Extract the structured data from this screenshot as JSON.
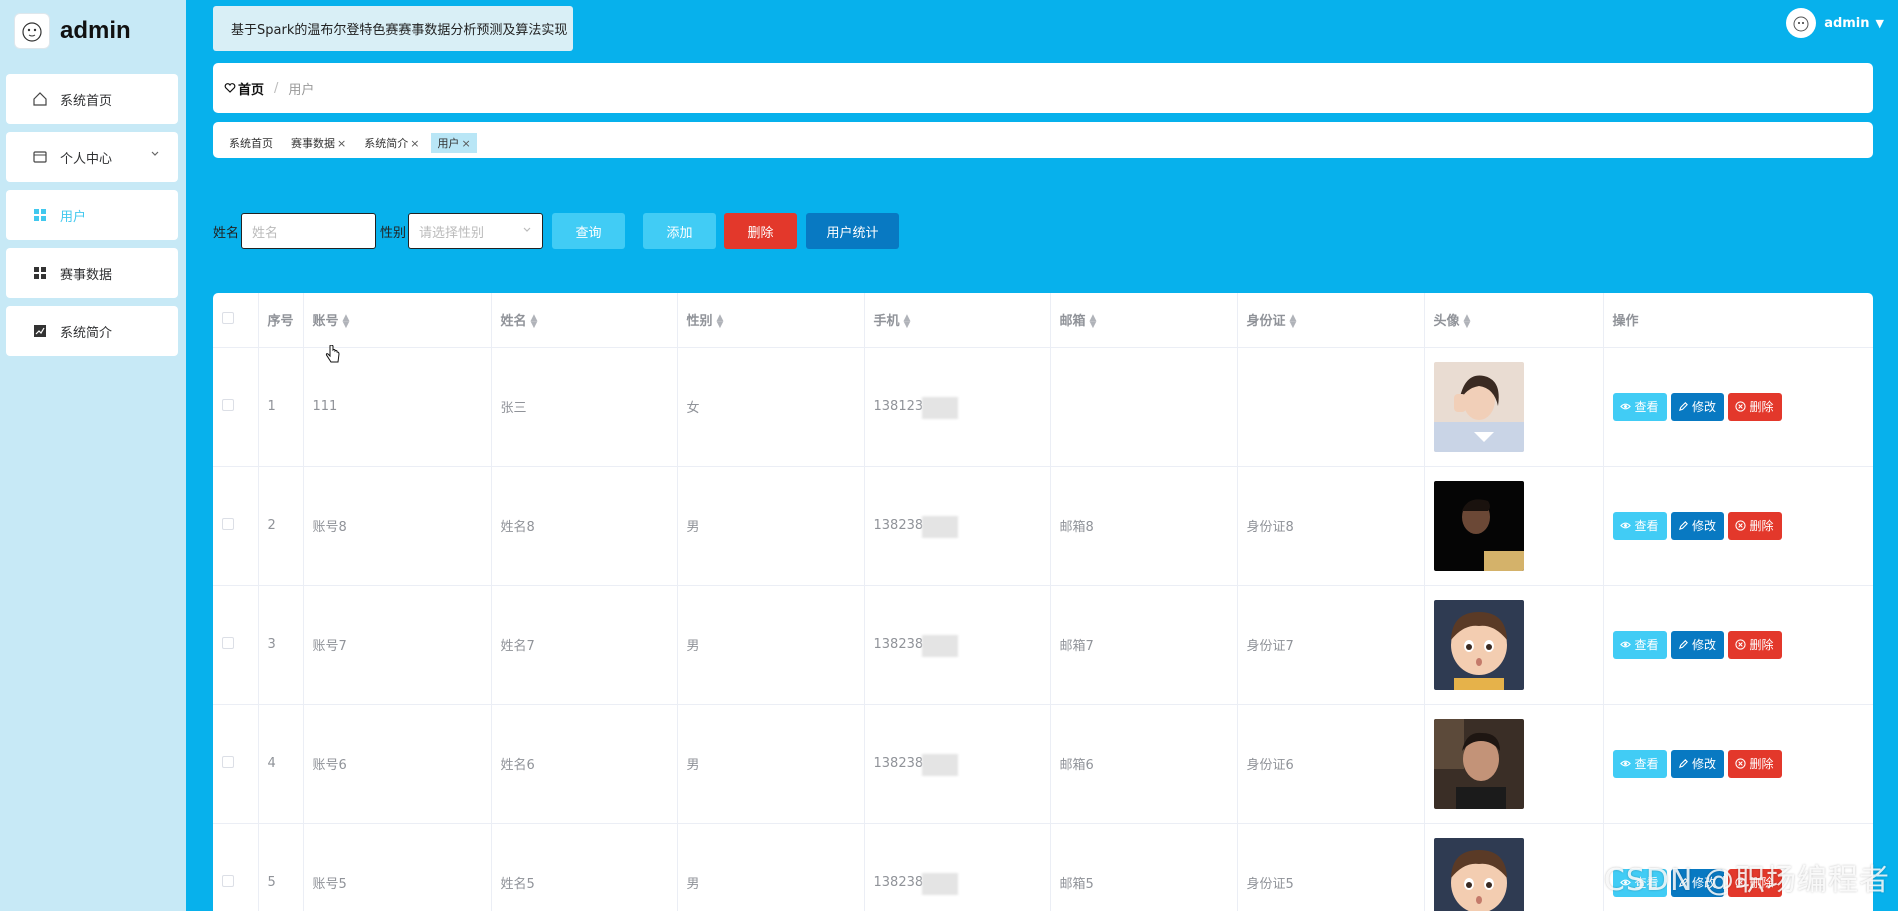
{
  "brand": {
    "name": "admin"
  },
  "sidebar": {
    "items": [
      {
        "label": "系统首页",
        "icon": "home-icon"
      },
      {
        "label": "个人中心",
        "icon": "card-icon"
      },
      {
        "label": "用户",
        "icon": "grid-icon"
      },
      {
        "label": "赛事数据",
        "icon": "grid-icon"
      },
      {
        "label": "系统简介",
        "icon": "chart-icon"
      }
    ]
  },
  "header": {
    "title": "基于Spark的温布尔登特色赛赛事数据分析预测及算法实现",
    "user": "admin"
  },
  "breadcrumb": {
    "home": "首页",
    "separator": "/",
    "current": "用户"
  },
  "tags": [
    {
      "label": "系统首页",
      "closable": false
    },
    {
      "label": "赛事数据",
      "closable": true
    },
    {
      "label": "系统简介",
      "closable": true
    },
    {
      "label": "用户",
      "closable": true
    }
  ],
  "search": {
    "name_label": "姓名",
    "name_placeholder": "姓名",
    "gender_label": "性别",
    "gender_placeholder": "请选择性别",
    "query": "查询",
    "add": "添加",
    "delete": "删除",
    "stats": "用户统计"
  },
  "table": {
    "headers": {
      "index": "序号",
      "account": "账号",
      "name": "姓名",
      "gender": "性别",
      "phone": "手机",
      "email": "邮箱",
      "idcard": "身份证",
      "avatar": "头像",
      "ops": "操作"
    },
    "rows": [
      {
        "index": "1",
        "account": "111",
        "name": "张三",
        "gender": "女",
        "phone": "138123",
        "email": "",
        "idcard": ""
      },
      {
        "index": "2",
        "account": "账号8",
        "name": "姓名8",
        "gender": "男",
        "phone": "138238",
        "email": "邮箱8",
        "idcard": "身份证8"
      },
      {
        "index": "3",
        "account": "账号7",
        "name": "姓名7",
        "gender": "男",
        "phone": "138238",
        "email": "邮箱7",
        "idcard": "身份证7"
      },
      {
        "index": "4",
        "account": "账号6",
        "name": "姓名6",
        "gender": "男",
        "phone": "138238",
        "email": "邮箱6",
        "idcard": "身份证6"
      },
      {
        "index": "5",
        "account": "账号5",
        "name": "姓名5",
        "gender": "男",
        "phone": "138238",
        "email": "邮箱5",
        "idcard": "身份证5"
      }
    ],
    "actions": {
      "view": "查看",
      "edit": "修改",
      "delete": "删除"
    }
  },
  "watermark": "CSDN @职场编程者",
  "colors": {
    "main_bg": "#07b1ec",
    "sidebar_bg": "#c7e9f6",
    "accent": "#41ccf5",
    "danger": "#e3382b",
    "primary": "#0879c2"
  }
}
